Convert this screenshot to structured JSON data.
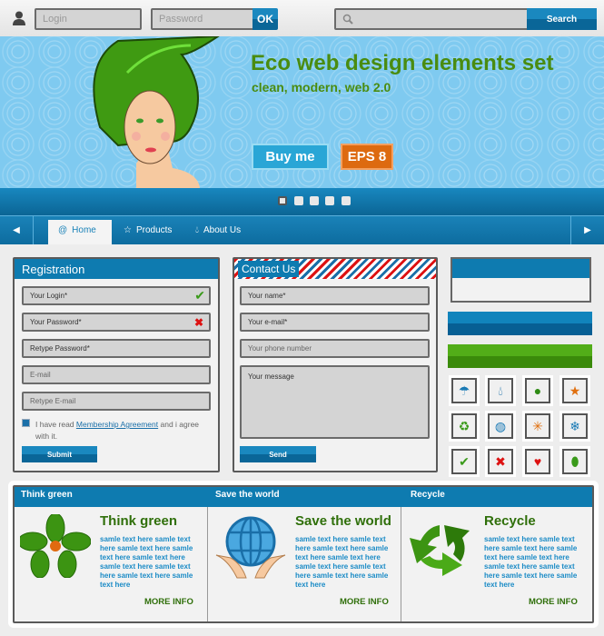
{
  "topbar": {
    "login_placeholder": "Login",
    "password_placeholder": "Password",
    "ok_label": "OK",
    "search_placeholder": "",
    "search_label": "Search"
  },
  "banner": {
    "title": "Eco web design elements set",
    "subtitle": "clean, modern, web 2.0",
    "buy_label": "Buy me",
    "eps_label": "EPS 8",
    "slides": 5,
    "active_slide": 1
  },
  "nav": {
    "items": [
      {
        "label": "Home",
        "icon": "swirl-icon"
      },
      {
        "label": "Products",
        "icon": "star-icon"
      },
      {
        "label": "About Us",
        "icon": "drop-icon"
      }
    ]
  },
  "registration": {
    "title": "Registration",
    "fields": [
      "Your Login*",
      "Your Password*",
      "Retype Password*",
      "E-mail",
      "Retype E-mail"
    ],
    "agree_pre": "I have read ",
    "agree_link": "Membership Agreement",
    "agree_post": " and i agree with it.",
    "submit": "Submit"
  },
  "contact": {
    "title": "Contact Us",
    "fields": [
      "Your name*",
      "Your e-mail*",
      "Your phone number"
    ],
    "message_placeholder": "Your message",
    "send": "Send"
  },
  "icons": [
    "umbrella-icon",
    "drop-icon",
    "lightbulb-icon",
    "star-icon",
    "recycle-icon",
    "globe-icon",
    "sun-icon",
    "snowflake-icon",
    "check-icon",
    "cross-icon",
    "heart-icon",
    "leaf-icon"
  ],
  "features": [
    {
      "tab": "Think green",
      "title": "Think green",
      "text": "samle text here samle text here samle text here samle text here samle text here samle text here samle text here samle text here samle text here",
      "more": "MORE INFO"
    },
    {
      "tab": "Save the world",
      "title": "Save the world",
      "text": "samle text here samle text here samle text here samle text here samle text here samle text here samle text here samle text here samle text here",
      "more": "MORE INFO"
    },
    {
      "tab": "Recycle",
      "title": "Recycle",
      "text": "samle text here samle text here samle text here samle text here samle text here samle text here samle text here samle text here samle text here",
      "more": "MORE INFO"
    }
  ],
  "colors": {
    "blue": "#0e7bb0",
    "green": "#2f6f0a",
    "orange": "#dd6a10",
    "sky": "#7fcaf0"
  }
}
